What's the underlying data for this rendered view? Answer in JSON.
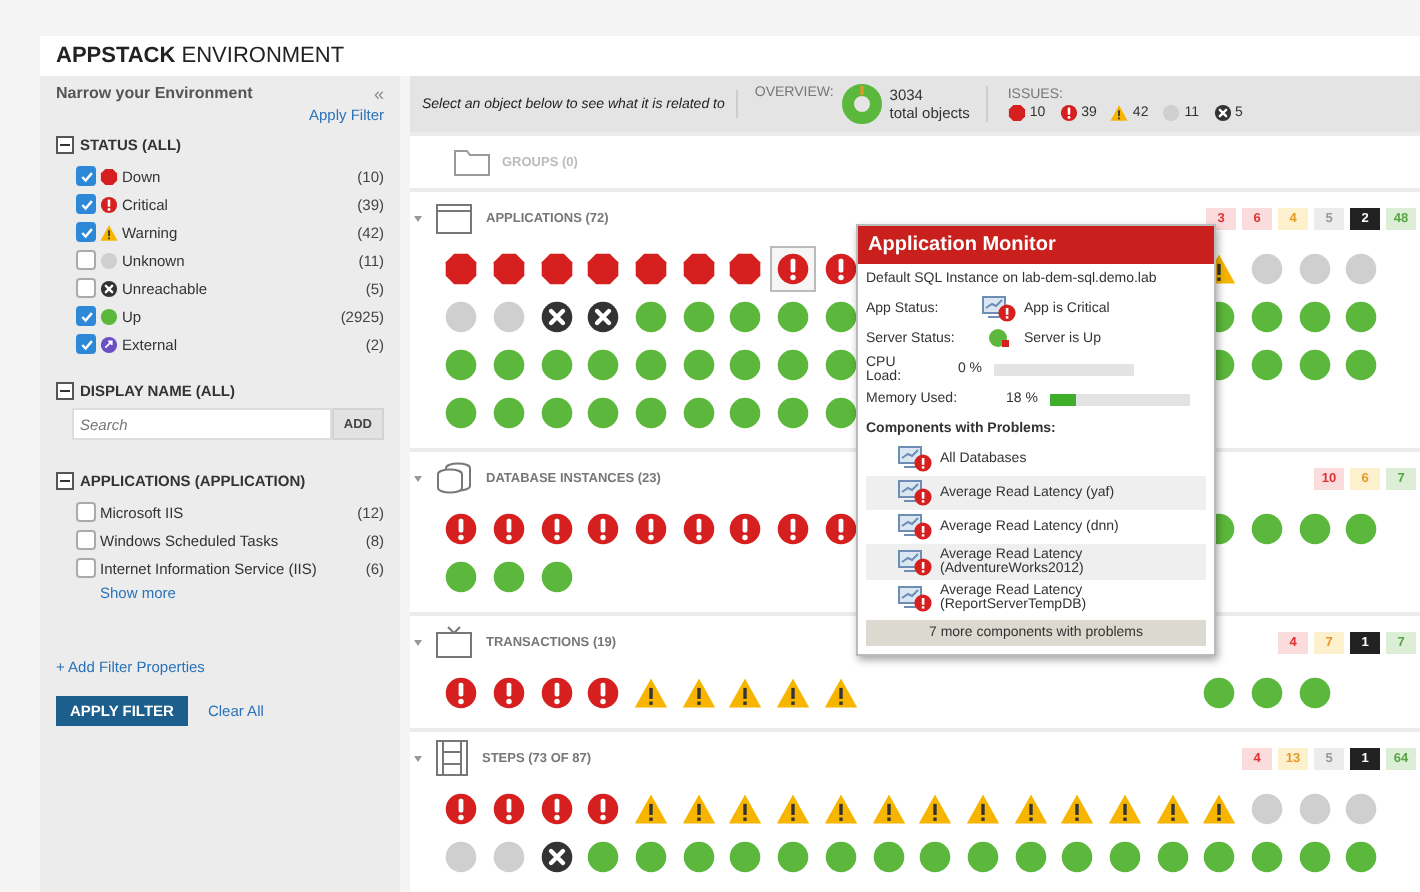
{
  "title": {
    "bold": "APPSTACK",
    "rest": "ENVIRONMENT"
  },
  "sidebar": {
    "heading": "Narrow your Environment",
    "collapse": "«",
    "apply_link": "Apply Filter",
    "status_filter": {
      "title": "STATUS (ALL)",
      "items": [
        {
          "label": "Down",
          "count": "(10)",
          "kind": "down",
          "checked": true
        },
        {
          "label": "Critical",
          "count": "(39)",
          "kind": "critical",
          "checked": true
        },
        {
          "label": "Warning",
          "count": "(42)",
          "kind": "warning",
          "checked": true
        },
        {
          "label": "Unknown",
          "count": "(11)",
          "kind": "unknown",
          "checked": false
        },
        {
          "label": "Unreachable",
          "count": "(5)",
          "kind": "unreachable",
          "checked": false
        },
        {
          "label": "Up",
          "count": "(2925)",
          "kind": "up",
          "checked": true
        },
        {
          "label": "External",
          "count": "(2)",
          "kind": "external",
          "checked": true
        }
      ]
    },
    "name_filter": {
      "title": "DISPLAY NAME (ALL)",
      "placeholder": "Search",
      "button": "ADD"
    },
    "app_filter": {
      "title": "APPLICATIONS (APPLICATION)",
      "items": [
        {
          "label": "Microsoft IIS",
          "count": "(12)",
          "checked": false
        },
        {
          "label": "Windows Scheduled Tasks",
          "count": "(8)",
          "checked": false
        },
        {
          "label": "Internet Information Service (IIS)",
          "count": "(6)",
          "checked": false
        }
      ],
      "more": "Show more"
    },
    "add_link": "+ Add Filter Properties",
    "apply_button": "APPLY FILTER",
    "clear_link": "Clear All"
  },
  "toolbar": {
    "hint": "Select an object below to see what it is related to",
    "overview_label": "OVERVIEW:",
    "total": "3034",
    "total_label": "total objects",
    "issues_label": "ISSUES:",
    "issues": [
      {
        "kind": "down",
        "count": "10"
      },
      {
        "kind": "critical",
        "count": "39"
      },
      {
        "kind": "warning",
        "count": "42"
      },
      {
        "kind": "unknown",
        "count": "11"
      },
      {
        "kind": "unreachable",
        "count": "5"
      }
    ]
  },
  "groups": {
    "label": "GROUPS (0)"
  },
  "sections": [
    {
      "kind": "applications",
      "title": "APPLICATIONS (72)",
      "badges": [
        {
          "kind": "down",
          "text": "3"
        },
        {
          "kind": "down",
          "text": "6"
        },
        {
          "kind": "warning",
          "text": "4"
        },
        {
          "kind": "unknown",
          "text": "5"
        },
        {
          "kind": "unreachable",
          "text": "2"
        },
        {
          "kind": "up",
          "text": "48"
        }
      ],
      "rows": [
        {
          "left": [
            {
              "kind": "down",
              "selected": false
            },
            {
              "kind": "down",
              "selected": false
            },
            {
              "kind": "down",
              "selected": false
            },
            {
              "kind": "down",
              "selected": false
            },
            {
              "kind": "down",
              "selected": false
            },
            {
              "kind": "down",
              "selected": false
            },
            {
              "kind": "down",
              "selected": false
            },
            {
              "kind": "critical",
              "selected": true
            },
            {
              "kind": "critical",
              "selected": false
            }
          ],
          "right": [
            {
              "kind": "warning",
              "selected": false
            },
            {
              "kind": "unknown",
              "selected": false
            },
            {
              "kind": "unknown",
              "selected": false
            },
            {
              "kind": "unknown",
              "selected": false
            }
          ]
        },
        {
          "left": [
            {
              "kind": "unknown",
              "selected": false
            },
            {
              "kind": "unknown",
              "selected": false
            },
            {
              "kind": "unreachable",
              "selected": false
            },
            {
              "kind": "unreachable",
              "selected": false
            },
            {
              "kind": "up",
              "selected": false
            },
            {
              "kind": "up",
              "selected": false
            },
            {
              "kind": "up",
              "selected": false
            },
            {
              "kind": "up",
              "selected": false
            },
            {
              "kind": "up",
              "selected": false
            }
          ],
          "right": [
            {
              "kind": "up",
              "selected": false
            },
            {
              "kind": "up",
              "selected": false
            },
            {
              "kind": "up",
              "selected": false
            },
            {
              "kind": "up",
              "selected": false
            }
          ]
        },
        {
          "left": [
            {
              "kind": "up",
              "selected": false
            },
            {
              "kind": "up",
              "selected": false
            },
            {
              "kind": "up",
              "selected": false
            },
            {
              "kind": "up",
              "selected": false
            },
            {
              "kind": "up",
              "selected": false
            },
            {
              "kind": "up",
              "selected": false
            },
            {
              "kind": "up",
              "selected": false
            },
            {
              "kind": "up",
              "selected": false
            },
            {
              "kind": "up",
              "selected": false
            }
          ],
          "right": [
            {
              "kind": "up",
              "selected": false
            },
            {
              "kind": "up",
              "selected": false
            },
            {
              "kind": "up",
              "selected": false
            },
            {
              "kind": "up",
              "selected": false
            }
          ]
        },
        {
          "left": [
            {
              "kind": "up",
              "selected": false
            },
            {
              "kind": "up",
              "selected": false
            },
            {
              "kind": "up",
              "selected": false
            },
            {
              "kind": "up",
              "selected": false
            },
            {
              "kind": "up",
              "selected": false
            },
            {
              "kind": "up",
              "selected": false
            },
            {
              "kind": "up",
              "selected": false
            },
            {
              "kind": "up",
              "selected": false
            },
            {
              "kind": "up",
              "selected": false
            }
          ]
        }
      ]
    },
    {
      "kind": "databases",
      "title": "DATABASE INSTANCES (23)",
      "badges": [
        {
          "kind": "down",
          "text": "10"
        },
        {
          "kind": "warning",
          "text": "6"
        },
        {
          "kind": "up",
          "text": "7"
        }
      ],
      "rows": [
        {
          "left": [
            {
              "kind": "critical",
              "selected": false
            },
            {
              "kind": "critical",
              "selected": false
            },
            {
              "kind": "critical",
              "selected": false
            },
            {
              "kind": "critical",
              "selected": false
            },
            {
              "kind": "critical",
              "selected": false
            },
            {
              "kind": "critical",
              "selected": false
            },
            {
              "kind": "critical",
              "selected": false
            },
            {
              "kind": "critical",
              "selected": false
            },
            {
              "kind": "critical",
              "selected": false
            }
          ],
          "right": [
            {
              "kind": "up",
              "selected": false
            },
            {
              "kind": "up",
              "selected": false
            },
            {
              "kind": "up",
              "selected": false
            },
            {
              "kind": "up",
              "selected": false
            }
          ]
        },
        {
          "left": [
            {
              "kind": "up",
              "selected": false
            },
            {
              "kind": "up",
              "selected": false
            },
            {
              "kind": "up",
              "selected": false
            }
          ]
        }
      ]
    },
    {
      "kind": "transactions",
      "title": "TRANSACTIONS (19)",
      "badges": [
        {
          "kind": "down",
          "text": "4"
        },
        {
          "kind": "warning",
          "text": "7"
        },
        {
          "kind": "unreachable",
          "text": "1"
        },
        {
          "kind": "up",
          "text": "7"
        }
      ],
      "rows": [
        {
          "left": [
            {
              "kind": "critical",
              "selected": false
            },
            {
              "kind": "critical",
              "selected": false
            },
            {
              "kind": "critical",
              "selected": false
            },
            {
              "kind": "critical",
              "selected": false
            },
            {
              "kind": "warning",
              "selected": false
            },
            {
              "kind": "warning",
              "selected": false
            },
            {
              "kind": "warning",
              "selected": false
            },
            {
              "kind": "warning",
              "selected": false
            },
            {
              "kind": "warning",
              "selected": false
            }
          ],
          "right": [
            {
              "kind": "up",
              "selected": false
            },
            {
              "kind": "up",
              "selected": false
            },
            {
              "kind": "up",
              "selected": false
            }
          ]
        }
      ]
    },
    {
      "kind": "steps",
      "title": "STEPS (73 OF 87)",
      "badges": [
        {
          "kind": "down",
          "text": "4"
        },
        {
          "kind": "warning",
          "text": "13"
        },
        {
          "kind": "unknown",
          "text": "5"
        },
        {
          "kind": "unreachable",
          "text": "1"
        },
        {
          "kind": "up",
          "text": "64"
        }
      ],
      "rows": [
        {
          "left": [
            {
              "kind": "critical",
              "selected": false
            },
            {
              "kind": "critical",
              "selected": false
            },
            {
              "kind": "critical",
              "selected": false
            },
            {
              "kind": "critical",
              "selected": false
            },
            {
              "kind": "warning",
              "selected": false
            },
            {
              "kind": "warning",
              "selected": false
            },
            {
              "kind": "warning",
              "selected": false
            },
            {
              "kind": "warning",
              "selected": false
            },
            {
              "kind": "warning",
              "selected": false
            },
            {
              "kind": "warning",
              "selected": false
            },
            {
              "kind": "warning",
              "selected": false
            },
            {
              "kind": "warning",
              "selected": false
            },
            {
              "kind": "warning",
              "selected": false
            },
            {
              "kind": "warning",
              "selected": false
            },
            {
              "kind": "warning",
              "selected": false
            },
            {
              "kind": "warning",
              "selected": false
            },
            {
              "kind": "warning",
              "selected": false
            },
            {
              "kind": "unknown",
              "selected": false
            },
            {
              "kind": "unknown",
              "selected": false
            },
            {
              "kind": "unknown",
              "selected": false
            }
          ]
        },
        {
          "left": [
            {
              "kind": "unknown",
              "selected": false
            },
            {
              "kind": "unknown",
              "selected": false
            },
            {
              "kind": "unreachable",
              "selected": false
            },
            {
              "kind": "up",
              "selected": false
            },
            {
              "kind": "up",
              "selected": false
            },
            {
              "kind": "up",
              "selected": false
            },
            {
              "kind": "up",
              "selected": false
            },
            {
              "kind": "up",
              "selected": false
            },
            {
              "kind": "up",
              "selected": false
            },
            {
              "kind": "up",
              "selected": false
            },
            {
              "kind": "up",
              "selected": false
            },
            {
              "kind": "up",
              "selected": false
            },
            {
              "kind": "up",
              "selected": false
            },
            {
              "kind": "up",
              "selected": false
            },
            {
              "kind": "up",
              "selected": false
            },
            {
              "kind": "up",
              "selected": false
            },
            {
              "kind": "up",
              "selected": false
            },
            {
              "kind": "up",
              "selected": false
            },
            {
              "kind": "up",
              "selected": false
            },
            {
              "kind": "up",
              "selected": false
            }
          ]
        }
      ]
    }
  ],
  "popup": {
    "title": "Application Monitor",
    "subtitle": "Default SQL Instance on lab-dem-sql.demo.lab",
    "fields": [
      {
        "kind": "status",
        "label": "App Status:",
        "value": "App is Critical"
      },
      {
        "kind": "status",
        "label": "Server Status:",
        "value": "Server is Up"
      },
      {
        "kind": "meter",
        "label": "CPU Load:",
        "value": "0 %",
        "level": 0
      },
      {
        "kind": "meter",
        "label": "Memory Used:",
        "value": "18 %",
        "level": 0.18
      }
    ],
    "components_title": "Components with Problems:",
    "components": [
      "All Databases",
      "Average Read Latency (yaf)",
      "Average Read Latency (dnn)",
      "Average Read Latency (AdventureWorks2012)",
      "Average Read Latency (ReportServerTempDB)"
    ],
    "more": "7 more components with problems"
  }
}
